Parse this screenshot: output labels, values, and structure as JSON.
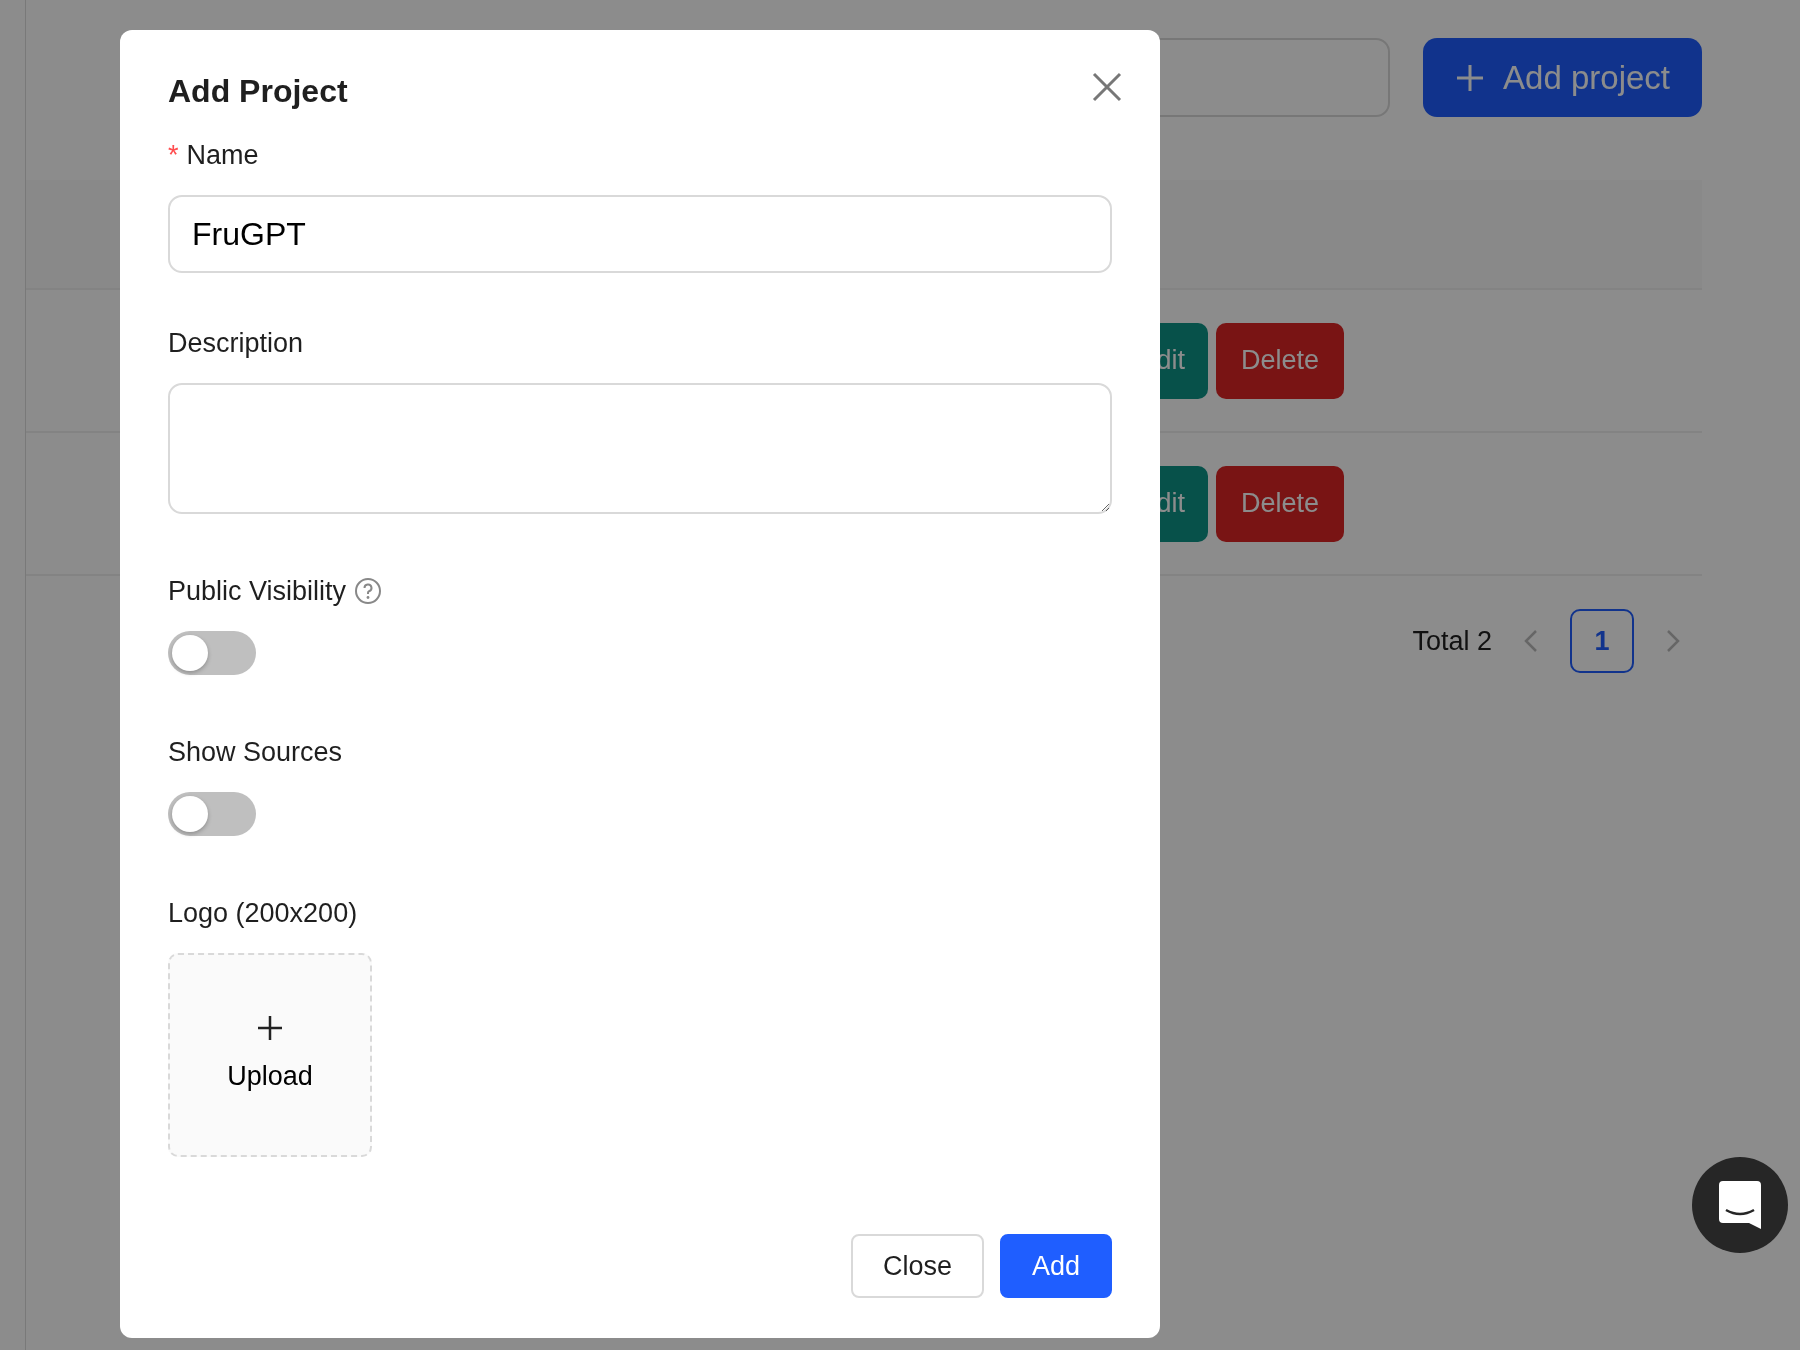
{
  "page": {
    "add_project_button": "Add project",
    "rows": [
      {
        "edit": "dit",
        "delete": "Delete"
      },
      {
        "edit": "dit",
        "delete": "Delete"
      }
    ],
    "pagination": {
      "total": "Total 2",
      "pages": [
        {
          "label": "1",
          "selected": true
        }
      ]
    }
  },
  "modal": {
    "title": "Add Project",
    "fields": [
      {
        "kind": "text",
        "label": "Name",
        "required_mark": "*",
        "value": "FruGPT"
      },
      {
        "kind": "textarea",
        "label": "Description"
      },
      {
        "kind": "switch",
        "label": "Public Visibility",
        "help": true,
        "on": false
      },
      {
        "kind": "switch",
        "label": "Show Sources",
        "help": false,
        "on": false
      },
      {
        "kind": "upload",
        "label": "Logo (200x200)",
        "button": "Upload"
      }
    ],
    "buttons": [
      {
        "label": "Close",
        "primary": false
      },
      {
        "label": "Add",
        "primary": true
      }
    ]
  }
}
